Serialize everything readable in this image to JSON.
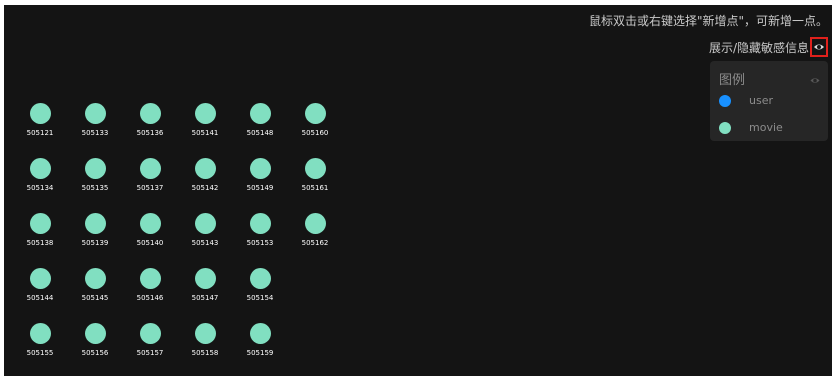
{
  "hint_text": "鼠标双击或右键选择\"新增点\"，可新增一点。",
  "toggle_text": "展示/隐藏敏感信息",
  "icons": {
    "toggle": "eye-icon",
    "legend": "eye-icon"
  },
  "legend": {
    "title": "图例",
    "items": [
      {
        "label": "user",
        "color": "#1890ff"
      },
      {
        "label": "movie",
        "color": "#81dfc1"
      }
    ]
  },
  "node_color": "#81dfc1",
  "nodes": [
    [
      "505121",
      "505133",
      "505136",
      "505141",
      "505148",
      "505160"
    ],
    [
      "505134",
      "505135",
      "505137",
      "505142",
      "505149",
      "505161"
    ],
    [
      "505138",
      "505139",
      "505140",
      "505143",
      "505153",
      "505162"
    ],
    [
      "505144",
      "505145",
      "505146",
      "505147",
      "505154"
    ],
    [
      "505155",
      "505156",
      "505157",
      "505158",
      "505159"
    ]
  ]
}
